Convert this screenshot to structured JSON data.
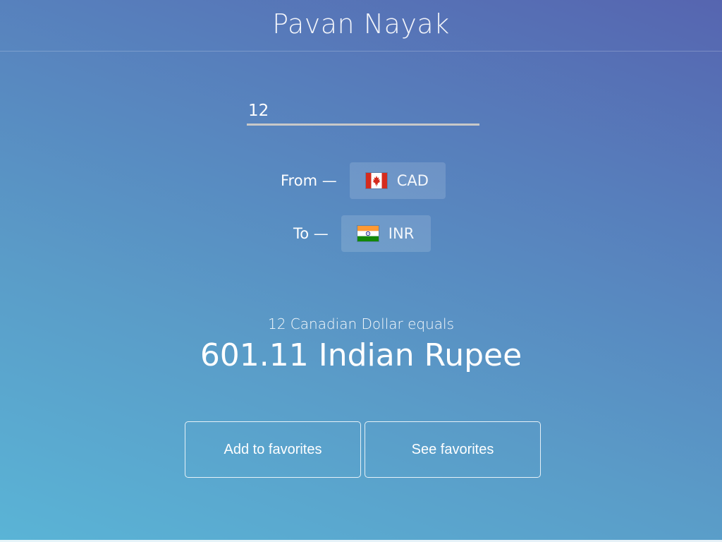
{
  "header": {
    "title": "Pavan Nayak"
  },
  "converter": {
    "amount_value": "12",
    "from": {
      "label": "From —",
      "currency_code": "CAD",
      "flag_icon": "canada-flag-icon"
    },
    "to": {
      "label": "To —",
      "currency_code": "INR",
      "flag_icon": "india-flag-icon"
    }
  },
  "result": {
    "subtitle": "12 Canadian Dollar equals",
    "value": "601.11 Indian Rupee"
  },
  "actions": {
    "add_label": "Add to favorites",
    "see_label": "See favorites"
  },
  "colors": {
    "gradient_light": "#5ab4d6",
    "gradient_dark": "#5665b0",
    "underline": "#c8c8c8",
    "canada_red": "#d52b1e",
    "india_saffron": "#ff9933",
    "india_green": "#138808",
    "india_chakra": "#000080"
  }
}
